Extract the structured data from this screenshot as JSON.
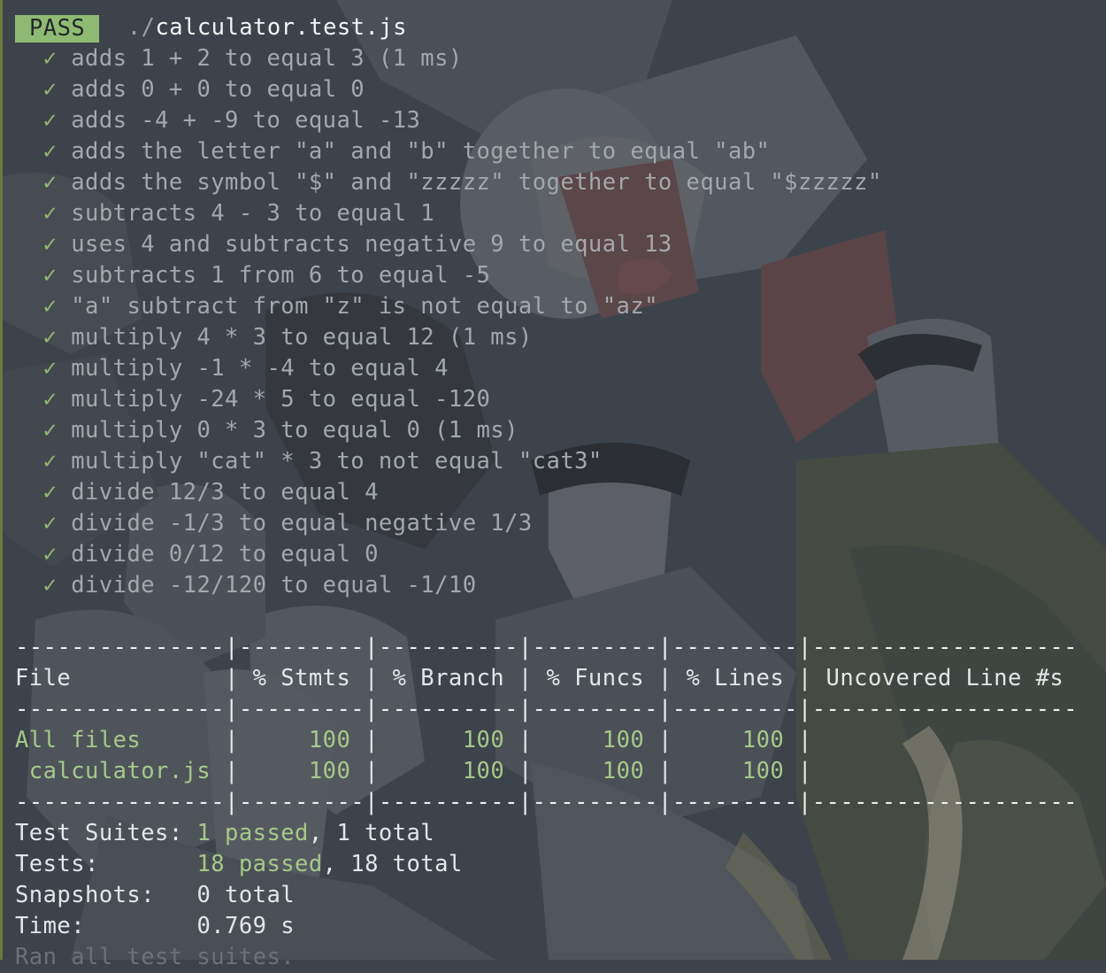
{
  "header": {
    "status_badge": "PASS",
    "path_prefix": "./",
    "file_name": "calculator.test.js"
  },
  "check_symbol": "✓",
  "tests": [
    "adds 1 + 2 to equal 3 (1 ms)",
    "adds 0 + 0 to equal 0",
    "adds -4 + -9 to equal -13",
    "adds the letter \"a\" and \"b\" together to equal \"ab\"",
    "adds the symbol \"$\" and \"zzzzz\" together to equal \"$zzzzz\"",
    "subtracts 4 - 3 to equal 1",
    "uses 4 and subtracts negative 9 to equal 13",
    "subtracts 1 from 6 to equal -5",
    "\"a\" subtract from \"z\" is not equal to \"az\"",
    "multiply 4 * 3 to equal 12 (1 ms)",
    "multiply -1 * -4 to equal 4",
    "multiply -24 * 5 to equal -120",
    "multiply 0 * 3 to equal 0 (1 ms)",
    "multiply \"cat\" * 3 to not equal \"cat3\"",
    "divide 12/3 to equal 4",
    "divide -1/3 to equal negative 1/3",
    "divide 0/12 to equal 0",
    "divide -12/120 to equal -1/10"
  ],
  "coverage": {
    "separator": "---------------|---------|----------|---------|---------|-------------------",
    "header_row": "File           | % Stmts | % Branch | % Funcs | % Lines | Uncovered Line #s ",
    "rows": [
      {
        "file": "All files      ",
        "stmts": "     100 ",
        "branch": "      100 ",
        "funcs": "     100 ",
        "lines": "     100 "
      },
      {
        "file": " calculator.js ",
        "stmts": "     100 ",
        "branch": "      100 ",
        "funcs": "     100 ",
        "lines": "     100 "
      }
    ],
    "pipe": "|"
  },
  "summary": {
    "suites_label": "Test Suites: ",
    "suites_passed": "1 passed",
    "suites_total": ", 1 total",
    "tests_label": "Tests:       ",
    "tests_passed": "18 passed",
    "tests_total": ", 18 total",
    "snapshots_label": "Snapshots:   ",
    "snapshots_value": "0 total",
    "time_label": "Time:        ",
    "time_value": "0.769 s",
    "footer": "Ran all test suites."
  },
  "colors": {
    "pass_green": "#8fba73",
    "coverage_green": "#a4c98a",
    "background": "#3d434a",
    "test_text": "#a3a8ad"
  }
}
